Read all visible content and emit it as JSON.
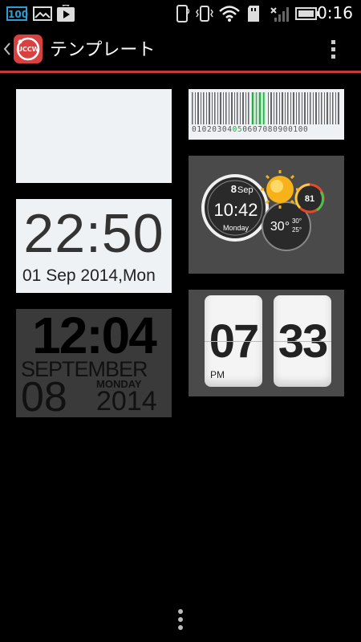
{
  "status_bar": {
    "battery_level_text": "100",
    "time": "0:16",
    "icons": [
      "battery-level-icon",
      "image-icon",
      "play-store-icon",
      "phone-icon",
      "vibrate-icon",
      "wifi-icon",
      "sd-card-icon",
      "signal-icon",
      "battery-icon"
    ]
  },
  "action_bar": {
    "title": "テンプレート",
    "app_icon_text": "UCCW"
  },
  "widgets": {
    "digital": {
      "time": "22:50",
      "date": "01 Sep 2014,Mon"
    },
    "big": {
      "time": "12:04",
      "month": "SEPTEMBER",
      "day": "08",
      "weekday": "MONDAY",
      "year": "2014"
    },
    "barcode": {
      "digits_pre": "01020304",
      "digits_hl": "05",
      "digits_post": "0607080900100"
    },
    "weather": {
      "day": "8",
      "month": "Sep",
      "time": "10:42",
      "weekday": "Monday",
      "temp": "30°",
      "high": "30°",
      "low": "25°",
      "battery": "81"
    },
    "flip": {
      "hour": "07",
      "minute": "33",
      "ampm": "PM"
    }
  },
  "colors": {
    "accent_red": "#c23a3a",
    "status_blue": "#2a9fd6",
    "barcode_green": "#2ba84a"
  }
}
